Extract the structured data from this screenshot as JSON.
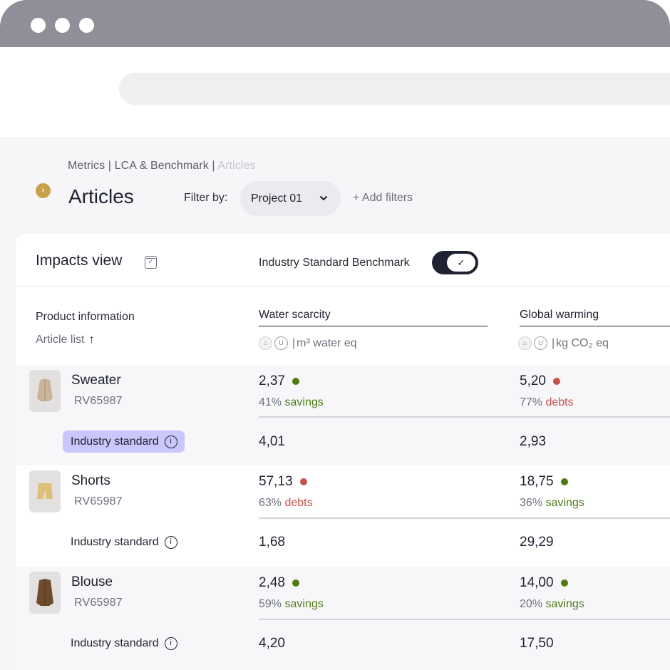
{
  "breadcrumb": {
    "part1": "Metrics | LCA & Benchmark |",
    "current": "Articles"
  },
  "page_title": "Articles",
  "filter": {
    "label": "Filter by:",
    "selected": "Project 01",
    "add_label": "+ Add filters"
  },
  "card": {
    "title": "Impacts view",
    "benchmark_label": "Industry Standard Benchmark",
    "benchmark_enabled": true
  },
  "columns": {
    "product": {
      "label": "Product information",
      "sort_label": "Article list"
    },
    "water": {
      "label": "Water scarcity",
      "unit": "m³ water eq"
    },
    "global": {
      "label": "Global warming",
      "unit": "kg CO₂ eq"
    }
  },
  "products": [
    {
      "name": "Sweater",
      "code": "RV65987",
      "water": {
        "value": "2,37",
        "status": "good",
        "pct": "41%",
        "note": "savings"
      },
      "global": {
        "value": "5,20",
        "status": "bad",
        "pct": "77%",
        "note": "debts"
      },
      "standard": {
        "label": "Industry standard",
        "water": "4,01",
        "global": "2,93"
      }
    },
    {
      "name": "Shorts",
      "code": "RV65987",
      "water": {
        "value": "57,13",
        "status": "bad",
        "pct": "63%",
        "note": "debts"
      },
      "global": {
        "value": "18,75",
        "status": "good",
        "pct": "36%",
        "note": "savings"
      },
      "standard": {
        "label": "Industry standard",
        "water": "1,68",
        "global": "29,29"
      }
    },
    {
      "name": "Blouse",
      "code": "RV65987",
      "water": {
        "value": "2,48",
        "status": "good",
        "pct": "59%",
        "note": "savings"
      },
      "global": {
        "value": "14,00",
        "status": "good",
        "pct": "20%",
        "note": "savings"
      },
      "standard": {
        "label": "Industry standard",
        "water": "4,20",
        "global": "17,50"
      }
    }
  ],
  "colors": {
    "accent": "#1f2230",
    "savings": "#4e7b12",
    "debts": "#c25149",
    "highlight": "#c9c7fb",
    "collapse": "#c9a14a"
  }
}
